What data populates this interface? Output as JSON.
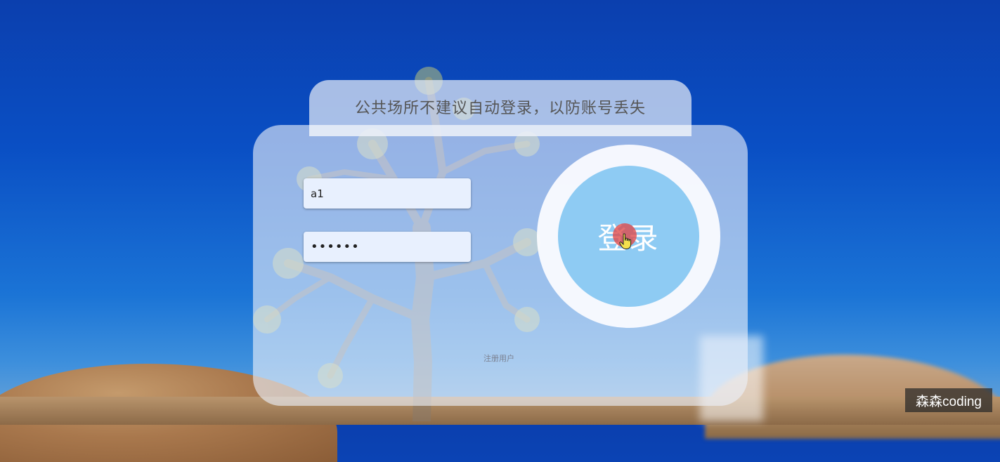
{
  "notice": {
    "text": "公共场所不建议自动登录，以防账号丢失"
  },
  "form": {
    "username_value": "a1",
    "password_value": "••••••"
  },
  "login_button": {
    "label": "登录"
  },
  "register_link": {
    "label": "注册用户"
  },
  "watermark": {
    "text": "森森coding"
  },
  "colors": {
    "sky": "#0b3fae",
    "button": "#8ecbf3",
    "input_bg": "#e8f0fe",
    "cursor_highlight": "#e04646"
  },
  "icons": [
    "pointer-hand-icon"
  ]
}
